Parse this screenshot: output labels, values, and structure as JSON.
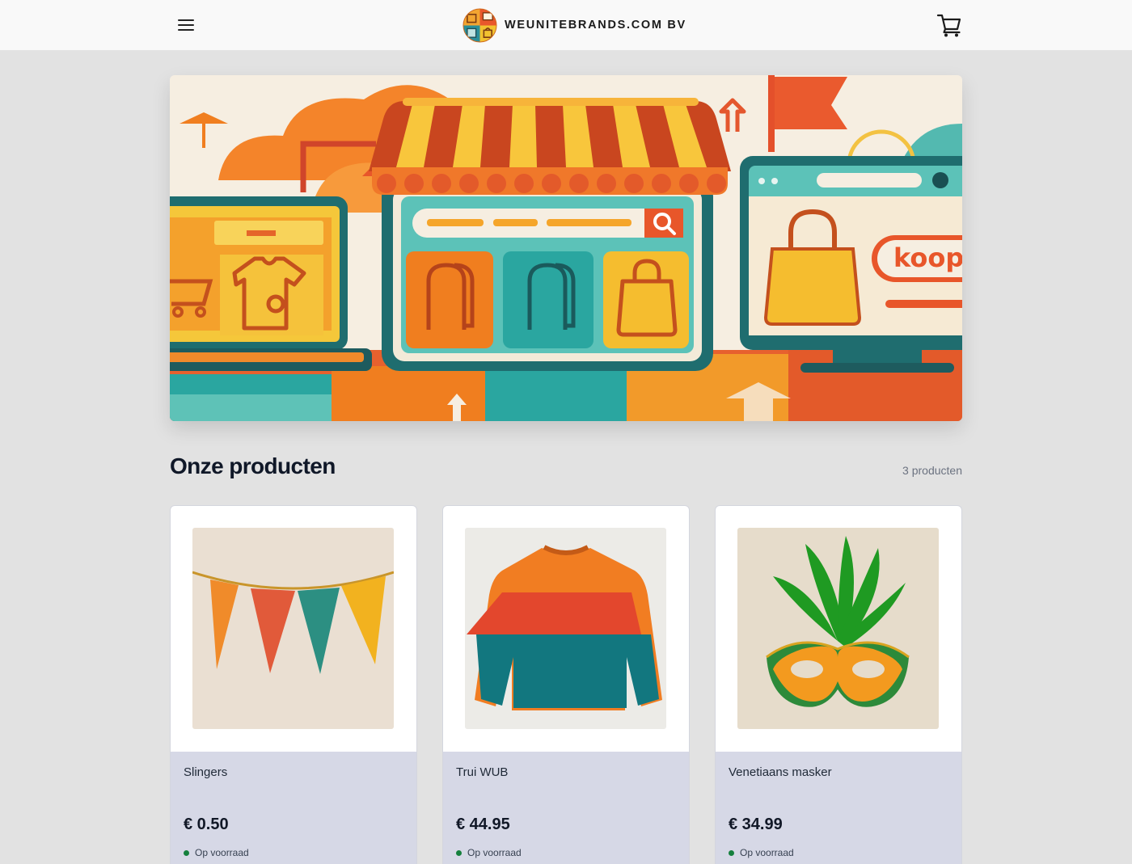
{
  "header": {
    "brand_name": "WEUNITEBRANDS.COM BV",
    "menu_icon": "hamburger-menu-icon",
    "cart_icon": "shopping-cart-icon"
  },
  "hero": {
    "sign_text": "koop"
  },
  "products_section": {
    "title": "Onze producten",
    "count_label": "3 producten"
  },
  "products": [
    {
      "name": "Slingers",
      "price": "€ 0.50",
      "stock": "Op voorraad"
    },
    {
      "name": "Trui WUB",
      "price": "€ 44.95",
      "stock": "Op voorraad"
    },
    {
      "name": "Venetiaans masker",
      "price": "€ 34.99",
      "stock": "Op voorraad"
    }
  ],
  "colors": {
    "accent_orange": "#f07e1f",
    "accent_teal": "#2aa6a0",
    "stock_green": "#15803d",
    "card_info_bg": "#d6d8e6",
    "page_bg": "#e2e2e2"
  }
}
